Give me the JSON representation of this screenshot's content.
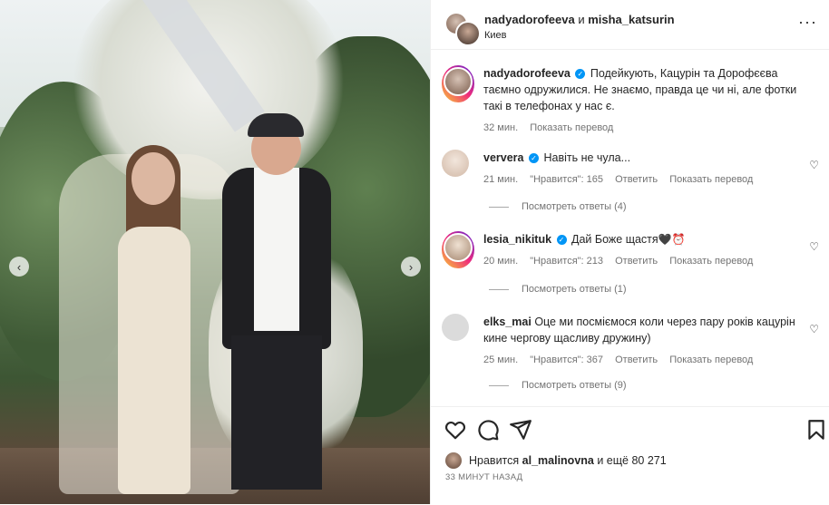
{
  "header": {
    "user1": "nadyadorofeeva",
    "joiner": "и",
    "user2": "misha_katsurin",
    "location": "Киев",
    "more": "···"
  },
  "caption": {
    "username": "nadyadorofeeva",
    "text": "Подейкують, Кацурін та Дорофєєва таємно одружилися. Не знаємо, правда це чи ні, але фотки такі в телефонах у нас є.",
    "time": "32 мин.",
    "translate": "Показать перевод"
  },
  "comments": [
    {
      "username": "ververa",
      "text": "Навіть не чула...",
      "time": "21 мин.",
      "likes": "\"Нравится\": 165",
      "reply": "Ответить",
      "translate": "Показать перевод",
      "replies": "Посмотреть ответы (4)"
    },
    {
      "username": "lesia_nikituk",
      "text": "Дай Боже щастя",
      "emoji": "🖤⏰",
      "time": "20 мин.",
      "likes": "\"Нравится\": 213",
      "reply": "Ответить",
      "translate": "Показать перевод",
      "replies": "Посмотреть ответы (1)"
    },
    {
      "username": "elks_mai",
      "text": "Оце ми посміємося коли через пару років кацурін кине чергову щасливу дружину)",
      "time": "25 мин.",
      "likes": "\"Нравится\": 367",
      "reply": "Ответить",
      "translate": "Показать перевод",
      "replies": "Посмотреть ответы (9)"
    }
  ],
  "likes": {
    "prefix": "Нравится",
    "user": "al_malinovna",
    "suffix": "и ещё 80 271"
  },
  "timeago": "33 МИНУТ НАЗАД",
  "carousel": {
    "prev": "‹",
    "next": "›"
  },
  "colors": {
    "verified": "#0095f6",
    "meta": "#737373",
    "text": "#262626"
  }
}
